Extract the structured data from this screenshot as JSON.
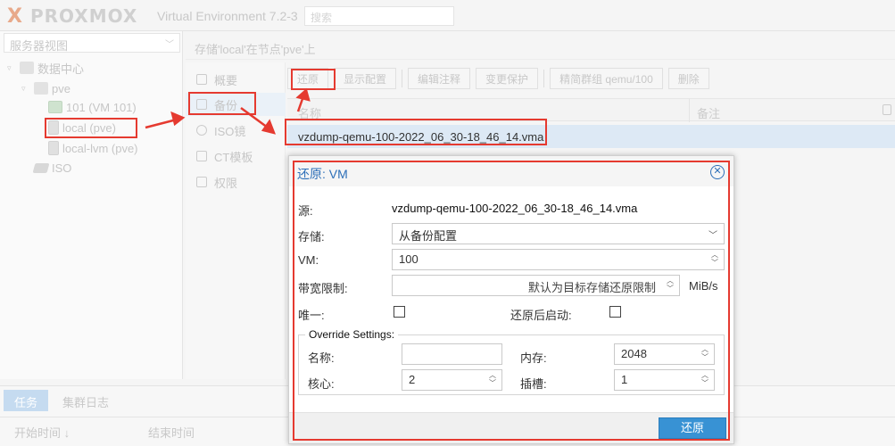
{
  "header": {
    "logo_text": "PROXMOX",
    "version": "Virtual Environment 7.2-3",
    "search_placeholder": "搜索"
  },
  "tree": {
    "view_label": "服务器视图",
    "nodes": [
      {
        "label": "数据中心"
      },
      {
        "label": "pve"
      },
      {
        "label": "101 (VM 101)"
      },
      {
        "label": "local (pve)"
      },
      {
        "label": "local-lvm (pve)"
      },
      {
        "label": "ISO"
      }
    ]
  },
  "content": {
    "title": "存储'local'在节点'pve'上"
  },
  "sidenav": {
    "items": [
      {
        "label": "概要"
      },
      {
        "label": "备份"
      },
      {
        "label": "ISO镜"
      },
      {
        "label": "CT模板"
      },
      {
        "label": "权限"
      }
    ]
  },
  "toolbar": {
    "buttons": [
      {
        "label": "还原"
      },
      {
        "label": "显示配置"
      },
      {
        "label": "编辑注释"
      },
      {
        "label": "变更保护"
      },
      {
        "label": "精简群组 qemu/100"
      },
      {
        "label": "删除"
      }
    ]
  },
  "grid": {
    "col_name": "名称",
    "col_note": "备注",
    "rows": [
      {
        "name": "vzdump-qemu-100-2022_06_30-18_46_14.vma"
      }
    ]
  },
  "tasks": {
    "tabs": [
      {
        "label": "任务"
      },
      {
        "label": "集群日志"
      }
    ],
    "cols": [
      "开始时间 ↓",
      "结束时间"
    ]
  },
  "dialog": {
    "title": "还原: VM",
    "source_label": "源:",
    "source_value": "vzdump-qemu-100-2022_06_30-18_46_14.vma",
    "storage_label": "存储:",
    "storage_value": "从备份配置",
    "vm_label": "VM:",
    "vm_value": "100",
    "bw_label": "带宽限制:",
    "bw_placeholder": "默认为目标存储还原限制",
    "bw_unit": "MiB/s",
    "unique_label": "唯一:",
    "start_label": "还原后启动:",
    "override_legend": "Override Settings:",
    "name_label": "名称:",
    "name_value": "",
    "memory_label": "内存:",
    "memory_value": "2048",
    "cores_label": "核心:",
    "cores_value": "2",
    "sockets_label": "插槽:",
    "sockets_value": "1",
    "ok_label": "还原"
  },
  "colors": {
    "accent": "#3892d4",
    "title_blue": "#2d6fb8",
    "annotation_red": "#e53a30",
    "selected_row": "#dde9f5"
  }
}
